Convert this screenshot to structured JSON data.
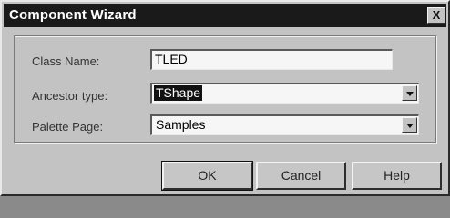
{
  "window": {
    "title": "Component Wizard",
    "close_glyph": "X"
  },
  "form": {
    "class_name": {
      "label": "Class Name:",
      "value": "TLED"
    },
    "ancestor_type": {
      "label": "Ancestor type:",
      "value": "TShape"
    },
    "palette_page": {
      "label": "Palette Page:",
      "value": "Samples"
    }
  },
  "buttons": {
    "ok": "OK",
    "cancel": "Cancel",
    "help": "Help"
  },
  "icons": {
    "dropdown": "chevron-down-icon",
    "close": "close-icon"
  }
}
